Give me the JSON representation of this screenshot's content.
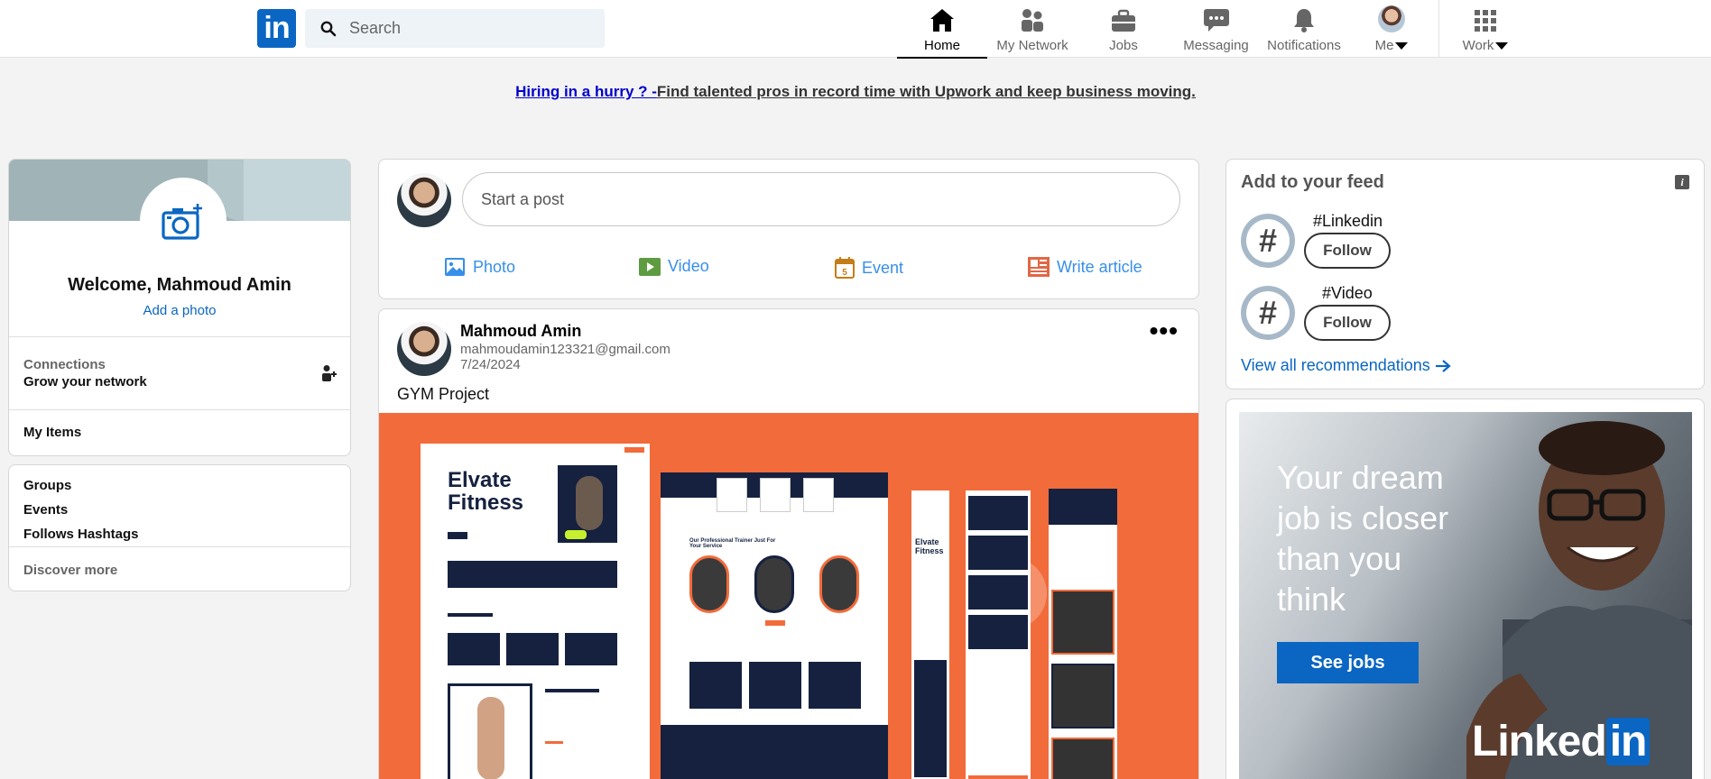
{
  "nav": {
    "logo": "in",
    "search_placeholder": "Search",
    "items": [
      {
        "label": "Home",
        "icon": "home-icon"
      },
      {
        "label": "My Network",
        "icon": "network-icon"
      },
      {
        "label": "Jobs",
        "icon": "briefcase-icon"
      },
      {
        "label": "Messaging",
        "icon": "messaging-icon"
      },
      {
        "label": "Notifications",
        "icon": "bell-icon"
      },
      {
        "label": "Me",
        "icon": "avatar"
      },
      {
        "label": "Work",
        "icon": "grid-icon"
      }
    ],
    "active": "Home"
  },
  "banner": {
    "link": "Hiring in a hurry ? -",
    "text": "Find talented pros in record time with Upwork and keep business moving."
  },
  "profile": {
    "welcome": "Welcome, Mahmoud Amin",
    "add_photo": "Add a photo",
    "connections_label": "Connections",
    "connections_sub": "Grow your network",
    "my_items": "My Items"
  },
  "discover": {
    "groups": "Groups",
    "events": "Events",
    "follows": "Follows Hashtags",
    "more": "Discover more"
  },
  "composer": {
    "placeholder": "Start a post",
    "actions": [
      {
        "label": "Photo",
        "icon": "photo-icon",
        "color": "#378fe9"
      },
      {
        "label": "Video",
        "icon": "video-icon",
        "color": "#5f9b41"
      },
      {
        "label": "Event",
        "icon": "calendar-icon",
        "color": "#c37d16"
      },
      {
        "label": "Write article",
        "icon": "article-icon",
        "color": "#e16745"
      }
    ]
  },
  "post": {
    "author": "Mahmoud Amin",
    "email": "mahmoudamin123321@gmail.com",
    "date": "7/24/2024",
    "text": "GYM Project",
    "menu": "•••",
    "mock_title": "Elvate Fitness",
    "mock_section": "Our Professional Trainer Just For Your Service"
  },
  "feed": {
    "title": "Add to your feed",
    "items": [
      {
        "tag": "#Linkedin",
        "button": "Follow"
      },
      {
        "tag": "#Video",
        "button": "Follow"
      }
    ],
    "view_all": "View all recommendations"
  },
  "ad": {
    "headline_lines": [
      "Your dream",
      "job is closer",
      "than you",
      "think"
    ],
    "button": "See jobs",
    "logo_text": "Linked",
    "logo_in": "in"
  }
}
